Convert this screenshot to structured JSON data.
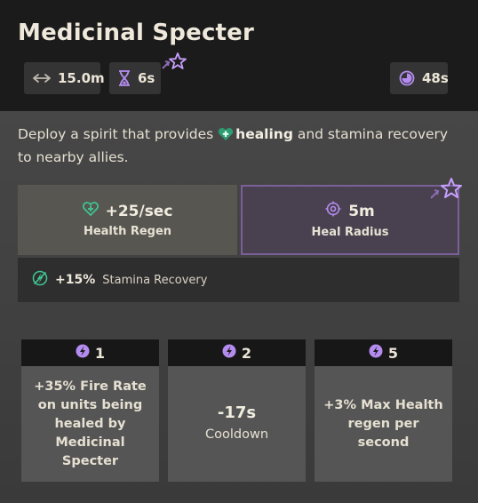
{
  "ability": {
    "title": "Medicinal Specter",
    "range": "15.0m",
    "duration": "6s",
    "cooldown": "48s"
  },
  "description": {
    "prefix": "Deploy a spirit that provides ",
    "highlight": "healing",
    "suffix": " and stamina recovery to nearby allies."
  },
  "stats": {
    "health_regen": {
      "value": "+25/sec",
      "label": "Health Regen",
      "icon": "heart-plus-icon"
    },
    "heal_radius": {
      "value": "5m",
      "label": "Heal Radius",
      "icon": "target-icon"
    },
    "stamina": {
      "value": "+15%",
      "label": "Stamina Recovery",
      "icon": "stamina-icon"
    }
  },
  "upgrades": [
    {
      "tier": "1",
      "text_bold_a": "+35% Fire Rate",
      "text_rest": " on units being healed by Medicinal Specter"
    },
    {
      "tier": "2",
      "big": "-17s",
      "small": "Cooldown"
    },
    {
      "tier": "5",
      "text": "+3% Max Health regen per second"
    }
  ],
  "colors": {
    "accent_purple": "#7b5f99",
    "heal_green": "#3fc28f",
    "ability_point": "#b48cf0"
  }
}
